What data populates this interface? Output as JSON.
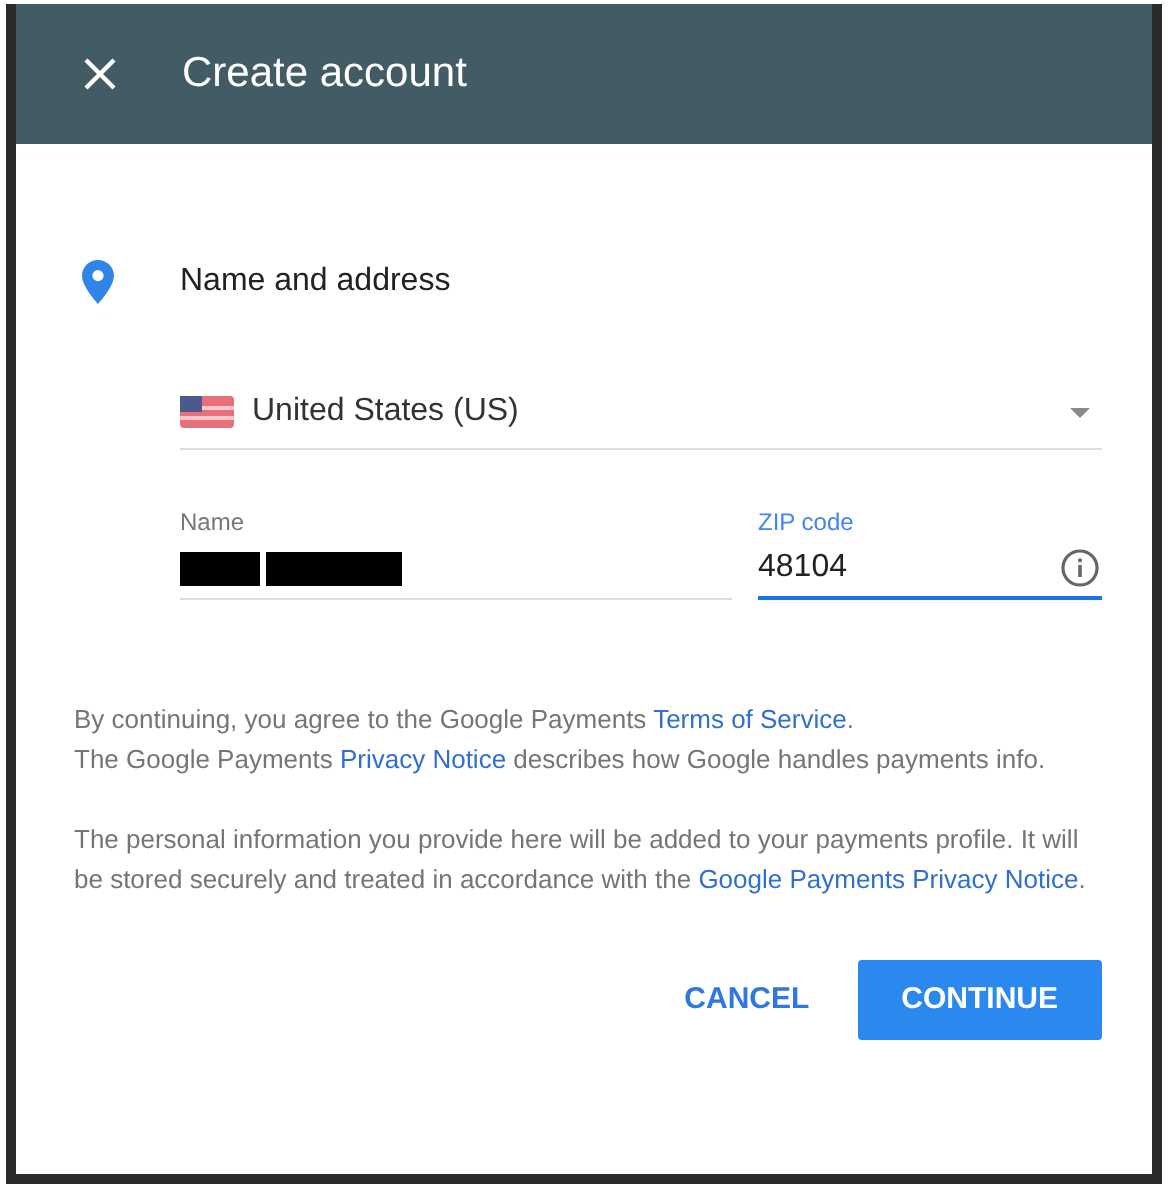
{
  "dialog": {
    "title": "Create account"
  },
  "section": {
    "title": "Name and address"
  },
  "country": {
    "value": "United States (US)"
  },
  "fields": [
    {
      "kind": "name",
      "label": "Name",
      "focused": false
    },
    {
      "kind": "zip",
      "label": "ZIP code",
      "value": "48104",
      "focused": true
    }
  ],
  "paragraphs": [
    [
      {
        "text": "By continuing, you agree to the Google Payments ",
        "kind": "text"
      },
      {
        "text": "Terms of Service",
        "kind": "link"
      },
      {
        "text": ".",
        "kind": "text"
      },
      {
        "text": "\nThe Google Payments ",
        "kind": "text"
      },
      {
        "text": "Privacy Notice",
        "kind": "link"
      },
      {
        "text": " describes how Google handles payments info.",
        "kind": "text"
      }
    ],
    [
      {
        "text": "The personal information you provide here will be added to your payments profile. It will be stored securely and treated in accordance with the ",
        "kind": "text"
      },
      {
        "text": "Google Payments Privacy Notice",
        "kind": "link"
      },
      {
        "text": ".",
        "kind": "text"
      }
    ]
  ],
  "buttons": [
    {
      "kind": "text",
      "label": "CANCEL"
    },
    {
      "kind": "filled",
      "label": "CONTINUE"
    }
  ]
}
